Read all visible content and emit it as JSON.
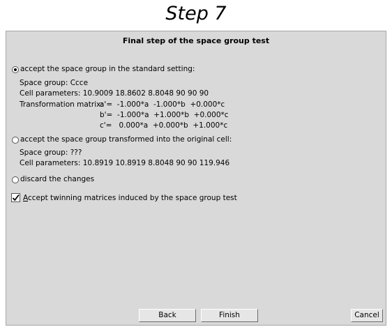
{
  "step_title": "Step 7",
  "dialog": {
    "title": "Final step of the space group test",
    "option_standard": {
      "label": "accept the space group in the standard setting:",
      "selected": true,
      "space_group": "Space group: Ccce",
      "cell_parameters": "Cell parameters: 10.9009 18.8602 8.8048 90 90 90",
      "matrix_label": "Transformation matrix:",
      "matrix_rows": [
        "a'=  -1.000*a  -1.000*b  +0.000*c",
        "b'=  -1.000*a  +1.000*b  +0.000*c",
        "c'=   0.000*a  +0.000*b  +1.000*c"
      ]
    },
    "option_original": {
      "label": "accept the space group transformed into the original cell:",
      "selected": false,
      "space_group": "Space group: ???",
      "cell_parameters": "Cell parameters: 10.8919 10.8919 8.8048 90 90 119.946"
    },
    "option_discard": {
      "label": "discard the changes",
      "selected": false
    },
    "twinning_checkbox": {
      "label_first": "A",
      "label_rest": "ccept twinning matrices induced by the space group test",
      "checked": true
    },
    "buttons": {
      "back": "Back",
      "finish": "Finish",
      "cancel": "Cancel"
    }
  }
}
